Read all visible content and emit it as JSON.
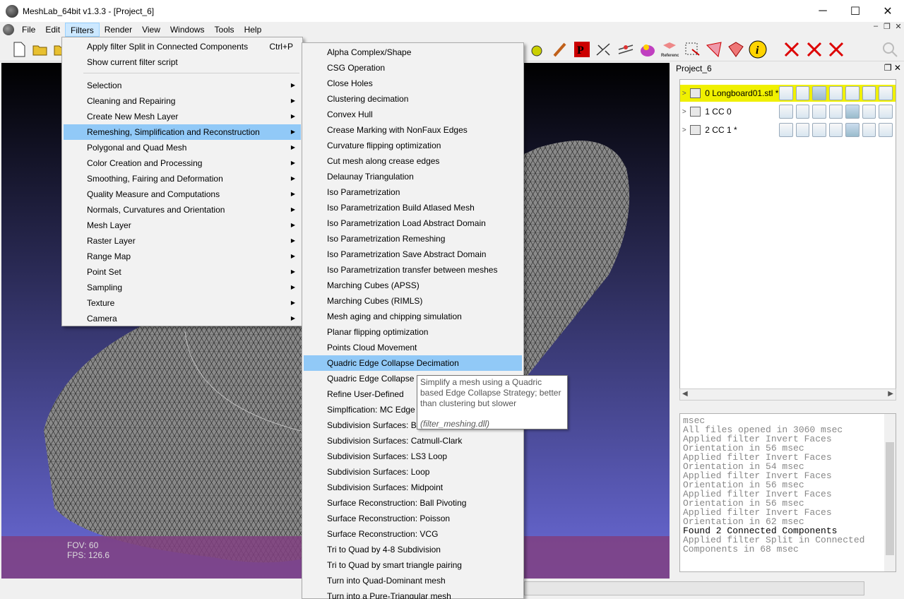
{
  "window": {
    "title": "MeshLab_64bit v1.3.3 - [Project_6]",
    "minimize": "─",
    "maximize": "☐",
    "close": "✕"
  },
  "menubar": {
    "items": [
      "File",
      "Edit",
      "Filters",
      "Render",
      "View",
      "Windows",
      "Tools",
      "Help"
    ],
    "active": "Filters",
    "mdi": [
      "–",
      "❐",
      "✕"
    ]
  },
  "filters_menu": {
    "top": [
      {
        "label": "Apply filter Split in Connected Components",
        "shortcut": "Ctrl+P"
      },
      {
        "label": "Show current filter script",
        "shortcut": ""
      }
    ],
    "groups": [
      "Selection",
      "Cleaning and Repairing",
      "Create New Mesh Layer",
      "Remeshing, Simplification and Reconstruction",
      "Polygonal and Quad Mesh",
      "Color Creation and Processing",
      "Smoothing, Fairing and Deformation",
      "Quality Measure and Computations",
      "Normals, Curvatures and Orientation",
      "Mesh Layer",
      "Raster Layer",
      "Range Map",
      "Point Set",
      "Sampling",
      "Texture",
      "Camera"
    ],
    "highlighted": "Remeshing, Simplification and Reconstruction",
    "submenu_arrow": "▶"
  },
  "remeshing_menu": {
    "items": [
      "Alpha Complex/Shape",
      "CSG Operation",
      "Close Holes",
      "Clustering decimation",
      "Convex Hull",
      "Crease Marking with NonFaux Edges",
      "Curvature flipping optimization",
      "Cut mesh along crease edges",
      "Delaunay Triangulation",
      "Iso Parametrization",
      "Iso Parametrization Build Atlased Mesh",
      "Iso Parametrization Load Abstract Domain",
      "Iso Parametrization Remeshing",
      "Iso Parametrization Save Abstract Domain",
      "Iso Parametrization transfer between meshes",
      "Marching Cubes (APSS)",
      "Marching Cubes (RIMLS)",
      "Mesh aging and chipping simulation",
      "Planar flipping optimization",
      "Points Cloud Movement",
      "Quadric Edge Collapse Decimation",
      "Quadric Edge Collapse D",
      "Refine User-Defined",
      "Simplfication: MC Edge",
      "Subdivision Surfaces: Bu",
      "Subdivision Surfaces: Catmull-Clark",
      "Subdivision Surfaces: LS3 Loop",
      "Subdivision Surfaces: Loop",
      "Subdivision Surfaces: Midpoint",
      "Surface Reconstruction: Ball Pivoting",
      "Surface Reconstruction: Poisson",
      "Surface Reconstruction: VCG",
      "Tri to Quad by 4-8 Subdivision",
      "Tri to Quad by smart triangle pairing",
      "Turn into Quad-Dominant mesh",
      "Turn into a Pure-Triangular mesh"
    ],
    "highlighted": "Quadric Edge Collapse Decimation"
  },
  "tooltip": {
    "text": "Simplify a mesh using a Quadric based Edge Collapse Strategy; better than clustering but slower",
    "dll": "(filter_meshing.dll)"
  },
  "viewport": {
    "fov": "FOV: 60",
    "fps": "FPS:   126.6",
    "mesh_color": "#8a8a8a",
    "bg_top": "#000000",
    "bg_bottom": "#6a6ad8",
    "band_color": "#804080"
  },
  "project_panel": {
    "title": "Project_6",
    "buttons": "❐ ✕",
    "layers": [
      {
        "label": "0  Longboard01.stl *",
        "selected": true
      },
      {
        "label": "1  CC 0",
        "selected": false
      },
      {
        "label": "2  CC 1 *",
        "selected": false
      }
    ],
    "arrow": ">",
    "scroll_left": "◀",
    "scroll_right": "▶",
    "selected_color": "#f0f000"
  },
  "log": {
    "lines": [
      {
        "text": "msec",
        "dark": false
      },
      {
        "text": "All files opened in 3060 msec",
        "dark": false
      },
      {
        "text": "Applied filter Invert Faces",
        "dark": false
      },
      {
        "text": "Orientation in 56 msec",
        "dark": false
      },
      {
        "text": "Applied filter Invert Faces",
        "dark": false
      },
      {
        "text": "Orientation in 54 msec",
        "dark": false
      },
      {
        "text": "Applied filter Invert Faces",
        "dark": false
      },
      {
        "text": "Orientation in 56 msec",
        "dark": false
      },
      {
        "text": "Applied filter Invert Faces",
        "dark": false
      },
      {
        "text": "Orientation in 56 msec",
        "dark": false
      },
      {
        "text": "Applied filter Invert Faces",
        "dark": false
      },
      {
        "text": "Orientation in 62 msec",
        "dark": false
      },
      {
        "text": "Found 2 Connected Components",
        "dark": true
      },
      {
        "text": "Applied filter Split in Connected",
        "dark": false
      },
      {
        "text": "Components in 68 msec",
        "dark": false
      }
    ]
  }
}
